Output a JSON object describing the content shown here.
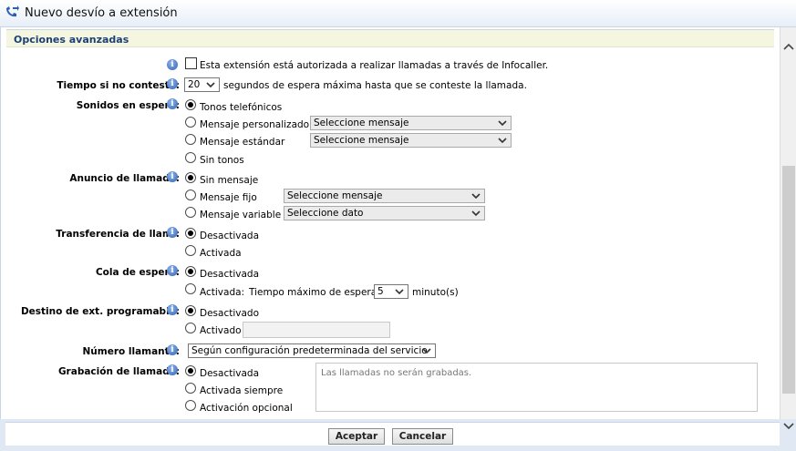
{
  "window": {
    "title": "Nuevo desvío a extensión"
  },
  "section": {
    "title": "Opciones avanzadas"
  },
  "infocaller": {
    "label": "Esta extensión está autorizada a realizar llamadas a través de Infocaller.",
    "checked": false
  },
  "no_answer": {
    "label": "Tiempo si no contesta:",
    "value": "20",
    "suffix": "segundos de espera máxima hasta que se conteste la llamada."
  },
  "hold_sounds": {
    "label": "Sonidos en espera:",
    "options": [
      "Tonos telefónicos",
      "Mensaje personalizado",
      "Mensaje estándar",
      "Sin tonos"
    ],
    "selected": 0,
    "custom_select": "Seleccione mensaje",
    "standard_select": "Seleccione mensaje"
  },
  "announcement": {
    "label": "Anuncio de llamada:",
    "options": [
      "Sin mensaje",
      "Mensaje fijo",
      "Mensaje variable"
    ],
    "selected": 0,
    "fixed_select": "Seleccione mensaje",
    "variable_select": "Seleccione dato"
  },
  "transfer": {
    "label": "Transferencia de llam.:",
    "options": [
      "Desactivada",
      "Activada"
    ],
    "selected": 0
  },
  "queue": {
    "label": "Cola de espera:",
    "options": [
      "Desactivada",
      "Activada:"
    ],
    "selected": 0,
    "max_wait_label": "Tiempo máximo de espera",
    "max_wait_value": "5",
    "unit": "minuto(s)"
  },
  "programmable": {
    "label": "Destino de ext. programable:",
    "options": [
      "Desactivado",
      "Activado"
    ],
    "selected": 0,
    "value": ""
  },
  "caller_number": {
    "label": "Número llamante:",
    "value": "Según configuración predeterminada del servicio"
  },
  "recording": {
    "label": "Grabación de llamada:",
    "options": [
      "Desactivada",
      "Activada siempre",
      "Activación opcional"
    ],
    "selected": 0,
    "note": "Las llamadas no serán grabadas."
  },
  "buttons": {
    "accept": "Aceptar",
    "cancel": "Cancelar"
  },
  "colors": {
    "section_title": "#1c3f7a",
    "section_bg": "#f4f6df",
    "info_icon": "#2e62b5"
  }
}
